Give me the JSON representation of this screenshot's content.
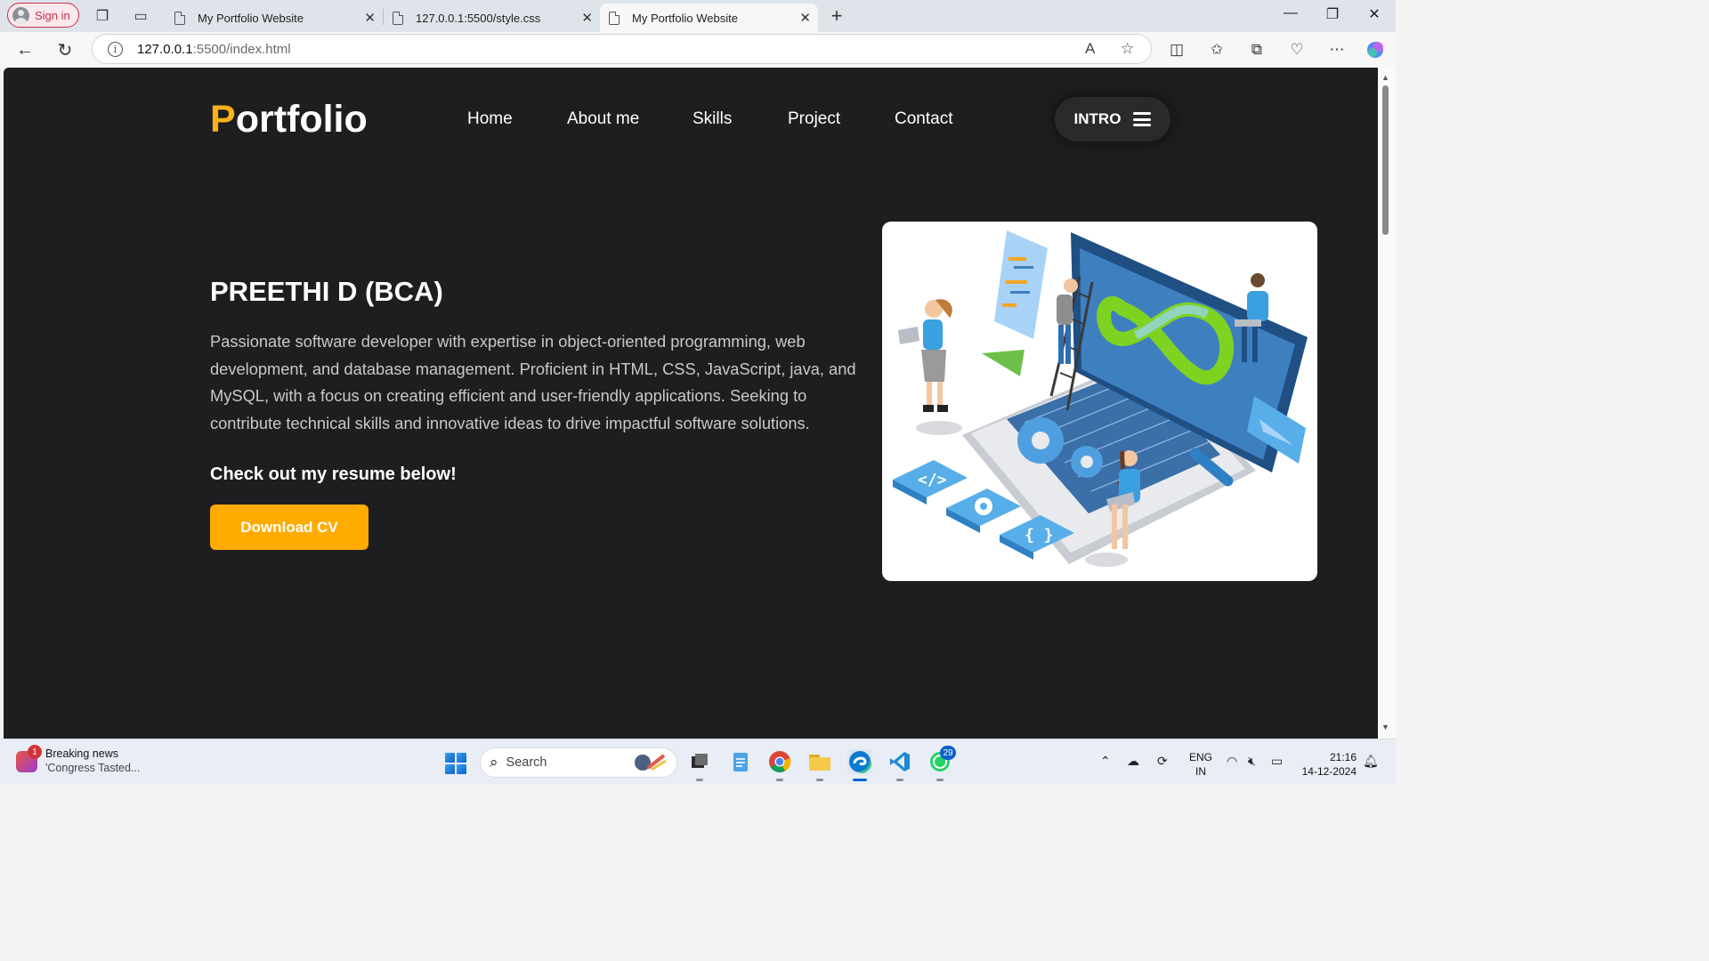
{
  "browser": {
    "signin_label": "Sign in",
    "tabs": [
      {
        "title": "My Portfolio Website",
        "active": false
      },
      {
        "title": "127.0.0.1:5500/style.css",
        "active": false
      },
      {
        "title": "My Portfolio Website",
        "active": true
      }
    ],
    "url_host": "127.0.0.1",
    "url_path": ":5500/index.html"
  },
  "site": {
    "logo_first": "P",
    "logo_rest": "ortfolio",
    "nav": [
      "Home",
      "About me",
      "Skills",
      "Project",
      "Contact"
    ],
    "intro_label": "INTRO",
    "name": "PREETHI D (BCA)",
    "bio": "Passionate software developer with expertise in object-oriented programming, web development, and database management. Proficient in HTML, CSS, JavaScript, java, and MySQL, with a focus on creating efficient and user-friendly applications. Seeking to contribute technical skills and innovative ideas to drive impactful software solutions.",
    "resume_note": "Check out my resume below!",
    "cv_button": "Download CV",
    "accent_color": "#ffab00",
    "background_color": "#1e1e20"
  },
  "taskbar": {
    "news_badge": "1",
    "news_title": "Breaking news",
    "news_subtitle": "'Congress Tasted...",
    "search_label": "Search",
    "whatsapp_badge": "29",
    "lang_line1": "ENG",
    "lang_line2": "IN",
    "time": "21:16",
    "date": "14-12-2024"
  }
}
